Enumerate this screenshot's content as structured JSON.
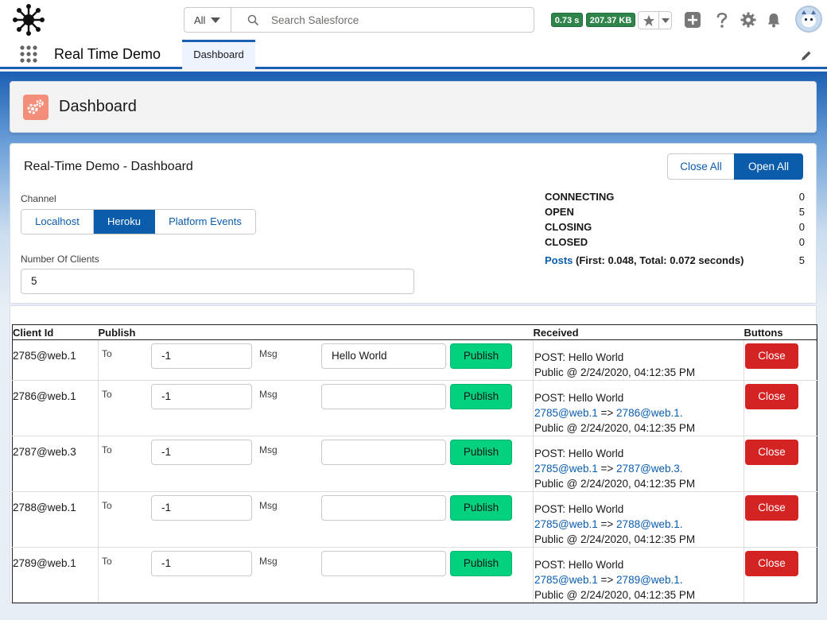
{
  "header": {
    "search_scope": "All",
    "search_placeholder": "Search Salesforce",
    "perf_time": "0.73 s",
    "perf_size": "207.37 KB"
  },
  "nav": {
    "app_name": "Real Time Demo",
    "tab_label": "Dashboard"
  },
  "page_header": {
    "title": "Dashboard"
  },
  "card": {
    "title": "Real-Time Demo - Dashboard",
    "close_all": "Close All",
    "open_all": "Open All",
    "channel_label": "Channel",
    "channels": [
      "Localhost",
      "Heroku",
      "Platform Events"
    ],
    "active_channel": "Heroku",
    "clients_label": "Number Of Clients",
    "clients_value": "5"
  },
  "stats": [
    {
      "label": "CONNECTING",
      "value": "0"
    },
    {
      "label": "OPEN",
      "value": "5"
    },
    {
      "label": "CLOSING",
      "value": "0"
    },
    {
      "label": "CLOSED",
      "value": "0"
    }
  ],
  "posts": {
    "link": "Posts",
    "detail": " (First: 0.048, Total: 0.072 seconds)",
    "value": "5"
  },
  "table": {
    "headers": [
      "Client Id",
      "Publish",
      "Received",
      "Buttons"
    ],
    "to_label": "To",
    "msg_label": "Msg",
    "publish_label": "Publish",
    "close_label": "Close",
    "rows": [
      {
        "client": "2785@web.1",
        "to": "-1",
        "msg": "Hello World",
        "recv1": "POST: Hello World",
        "from": "",
        "arrow": "",
        "target": "",
        "recv3": "Public @ 2/24/2020, 04:12:35 PM"
      },
      {
        "client": "2786@web.1",
        "to": "-1",
        "msg": "",
        "recv1": "POST: Hello World",
        "from": "2785@web.1",
        "arrow": " => ",
        "target": "2786@web.1.",
        "recv3": "Public @ 2/24/2020, 04:12:35 PM"
      },
      {
        "client": "2787@web.3",
        "to": "-1",
        "msg": "",
        "recv1": "POST: Hello World",
        "from": "2785@web.1",
        "arrow": " => ",
        "target": "2787@web.3.",
        "recv3": "Public @ 2/24/2020, 04:12:35 PM"
      },
      {
        "client": "2788@web.1",
        "to": "-1",
        "msg": "",
        "recv1": "POST: Hello World",
        "from": "2785@web.1",
        "arrow": " => ",
        "target": "2788@web.1.",
        "recv3": "Public @ 2/24/2020, 04:12:35 PM"
      },
      {
        "client": "2789@web.1",
        "to": "-1",
        "msg": "",
        "recv1": "POST: Hello World",
        "from": "2785@web.1",
        "arrow": " => ",
        "target": "2789@web.1.",
        "recv3": "Public @ 2/24/2020, 04:12:35 PM"
      }
    ]
  },
  "colors": {
    "brand": "#0b5cab",
    "publish": "#04d17e",
    "close": "#d42323",
    "perf": "#2e844a"
  }
}
